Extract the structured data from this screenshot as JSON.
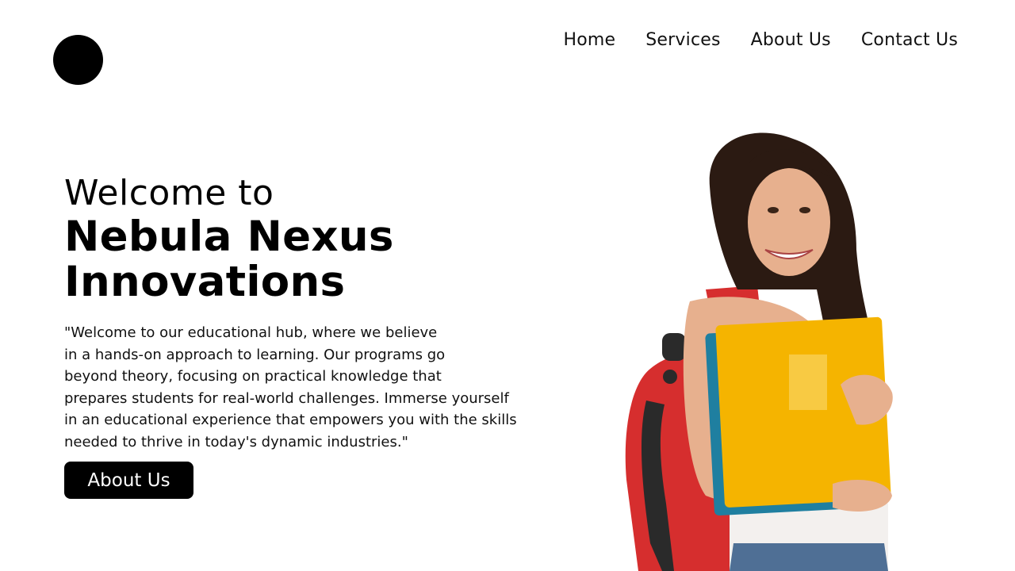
{
  "nav": {
    "items": [
      "Home",
      "Services",
      "About Us",
      "Contact Us"
    ]
  },
  "hero": {
    "welcome": "Welcome to",
    "brand_line1": "Nebula Nexus",
    "brand_line2": "Innovations",
    "description_lines": [
      "\"Welcome to our educational hub, where we believe",
      "in a hands-on approach to learning. Our programs go",
      "beyond theory, focusing on practical knowledge that",
      "prepares students for real-world challenges. Immerse yourself",
      "in an educational experience that empowers you with the skills",
      "needed to thrive in today's dynamic industries.\""
    ],
    "cta_label": "About Us"
  },
  "colors": {
    "background": "#ffffff",
    "text": "#000000",
    "button": "#000000",
    "backpack": "#d62e2e",
    "folder": "#f5b400",
    "folder_back": "#1f7fa0",
    "hair": "#2b1a12",
    "skin": "#e7b08e"
  },
  "icons": {
    "logo": "black-circle-logo"
  }
}
